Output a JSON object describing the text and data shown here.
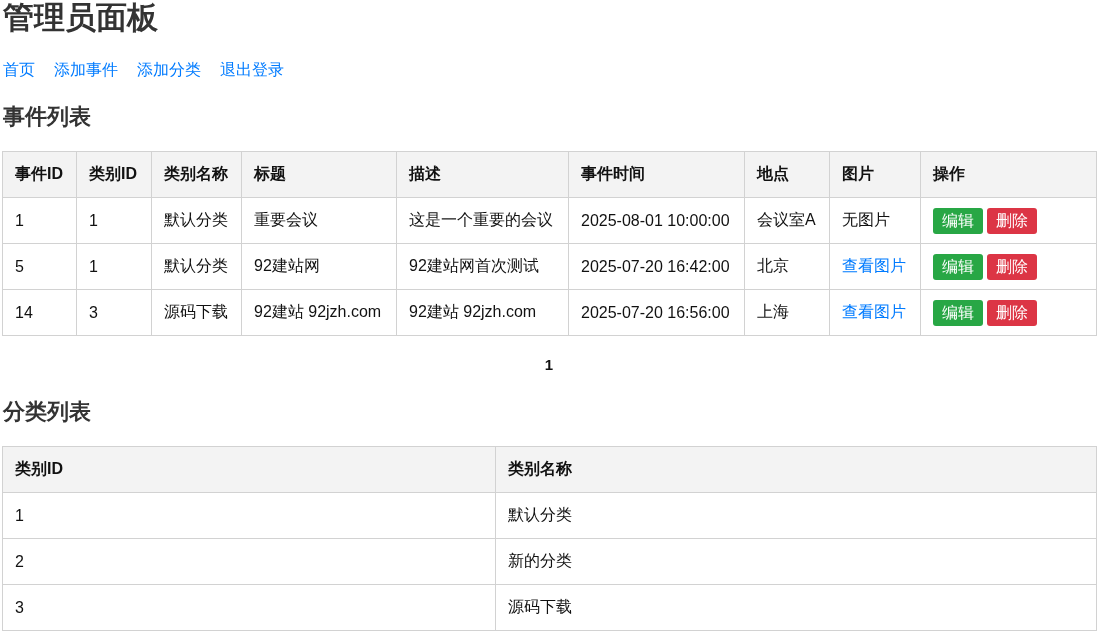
{
  "page_title": "管理员面板",
  "nav": [
    "首页",
    "添加事件",
    "添加分类",
    "退出登录"
  ],
  "events": {
    "title": "事件列表",
    "columns": [
      "事件ID",
      "类别ID",
      "类别名称",
      "标题",
      "描述",
      "事件时间",
      "地点",
      "图片",
      "操作"
    ],
    "rows": [
      {
        "cells": [
          "1",
          "1",
          "默认分类",
          "重要会议",
          "这是一个重要的会议",
          "2025-08-01 10:00:00",
          "会议室A"
        ],
        "image": {
          "kind": "text",
          "label": "无图片"
        },
        "actions": [
          {
            "kind": "edit",
            "label": "编辑"
          },
          {
            "kind": "delete",
            "label": "删除"
          }
        ]
      },
      {
        "cells": [
          "5",
          "1",
          "默认分类",
          "92建站网",
          "92建站网首次测试",
          "2025-07-20 16:42:00",
          "北京"
        ],
        "image": {
          "kind": "link",
          "label": "查看图片"
        },
        "actions": [
          {
            "kind": "edit",
            "label": "编辑"
          },
          {
            "kind": "delete",
            "label": "删除"
          }
        ]
      },
      {
        "cells": [
          "14",
          "3",
          "源码下载",
          "92建站 92jzh.com",
          "92建站 92jzh.com",
          "2025-07-20 16:56:00",
          "上海"
        ],
        "image": {
          "kind": "link",
          "label": "查看图片"
        },
        "actions": [
          {
            "kind": "edit",
            "label": "编辑"
          },
          {
            "kind": "delete",
            "label": "删除"
          }
        ]
      }
    ]
  },
  "pagination": [
    {
      "label": "1",
      "selected": true
    }
  ],
  "categories": {
    "title": "分类列表",
    "columns": [
      "类别ID",
      "类别名称"
    ],
    "rows": [
      [
        "1",
        "默认分类"
      ],
      [
        "2",
        "新的分类"
      ],
      [
        "3",
        "源码下载"
      ]
    ]
  }
}
